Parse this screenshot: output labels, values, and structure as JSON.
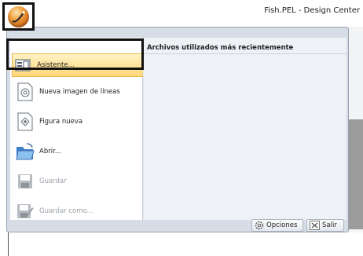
{
  "window": {
    "title": "Fish.PEL - Design Center"
  },
  "menu": {
    "recent_header": "Archivos utilizados más recientemente",
    "items": [
      {
        "label": "Asistente...",
        "icon": "wizard-icon"
      },
      {
        "label": "Nueva imagen de líneas",
        "icon": "new-line-image-icon"
      },
      {
        "label": "Figura nueva",
        "icon": "new-figure-icon"
      },
      {
        "label": "Abrir...",
        "icon": "open-folder-icon"
      },
      {
        "label": "Guardar",
        "icon": "save-icon"
      },
      {
        "label": "Guardar como...",
        "icon": "save-as-icon"
      }
    ],
    "options_button": {
      "label": "Opciones",
      "icon": "gear-icon"
    },
    "exit_button": {
      "label": "Salir",
      "icon": "exit-icon"
    }
  }
}
